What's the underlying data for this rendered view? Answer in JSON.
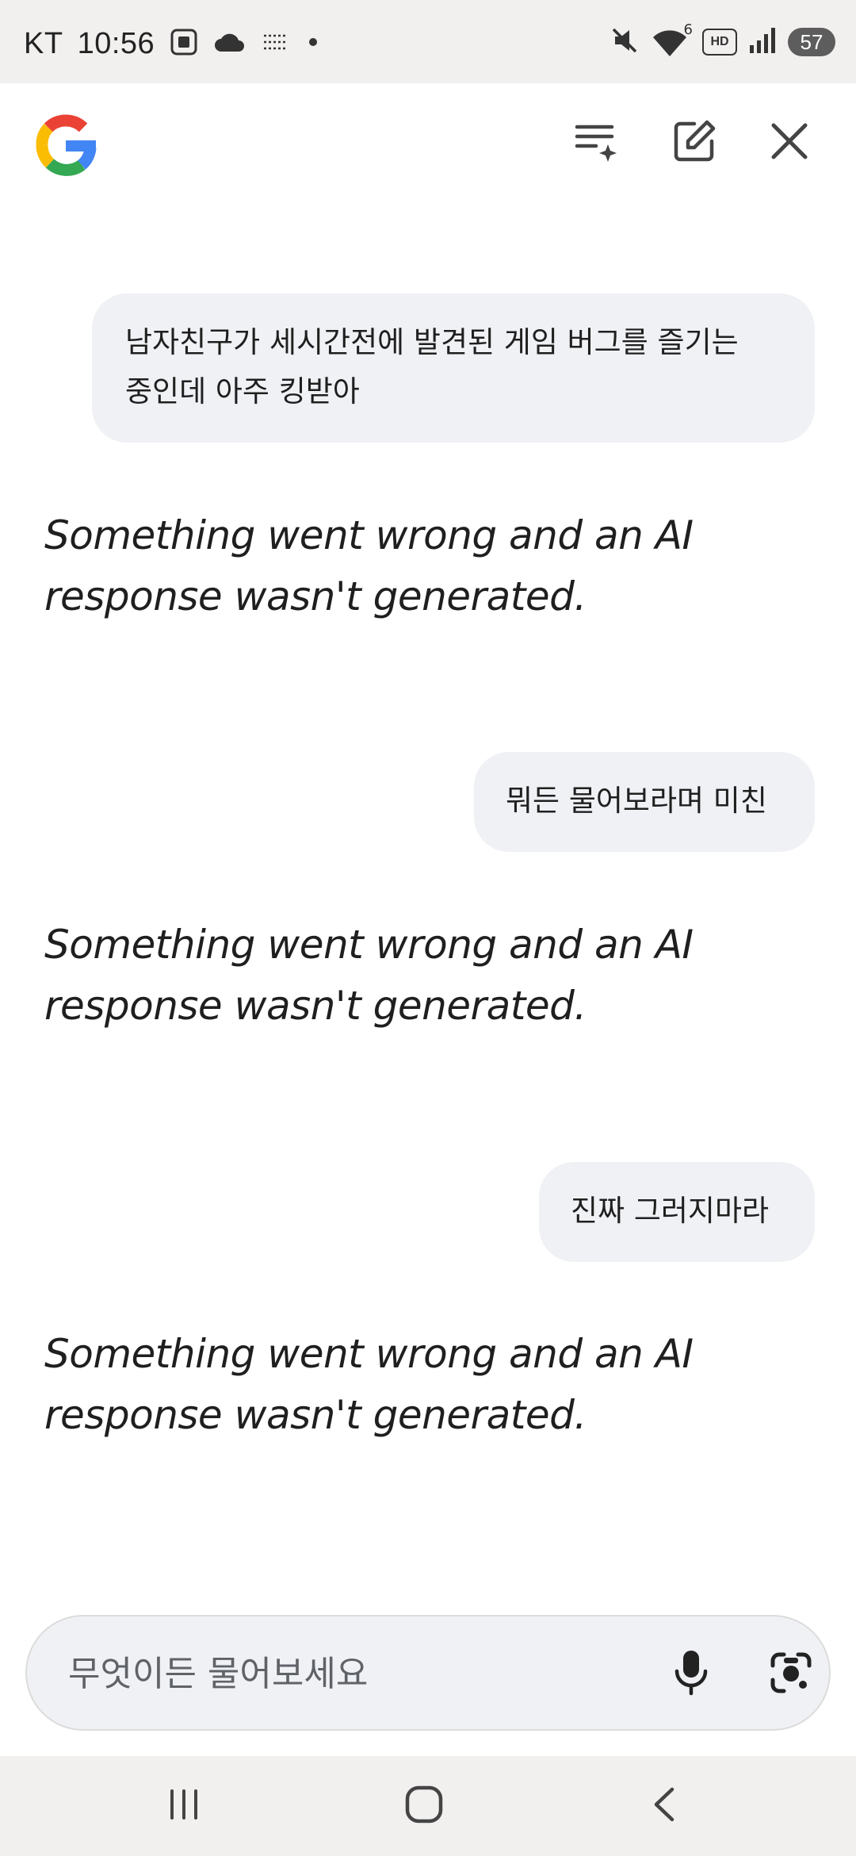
{
  "status_bar": {
    "carrier": "KT",
    "time": "10:56",
    "battery": "57",
    "wifi_label": "6",
    "hd_label": "HD"
  },
  "header": {
    "logo_icon": "google-g-logo",
    "actions": [
      "history-sparkle-icon",
      "new-chat-icon",
      "close-icon"
    ]
  },
  "conversation": {
    "messages": [
      {
        "role": "user",
        "text": "남자친구가 세시간전에 발견된 게임 버그를 즐기는\n중인데 아주 킹받아"
      },
      {
        "role": "assistant",
        "text": "Something went wrong and an AI response wasn't generated."
      },
      {
        "role": "user",
        "text": "뭐든 물어보라며 미친"
      },
      {
        "role": "assistant",
        "text": "Something went wrong and an AI response wasn't generated."
      },
      {
        "role": "user",
        "text": "진짜 그러지마라"
      },
      {
        "role": "assistant",
        "text": "Something went wrong and an AI response wasn't generated."
      }
    ]
  },
  "input": {
    "placeholder": "무엇이든 물어보세요",
    "value": ""
  },
  "colors": {
    "bubble_bg": "#f0f1f5",
    "statusbar_bg": "#f2efef",
    "text": "#1f1f1f"
  }
}
